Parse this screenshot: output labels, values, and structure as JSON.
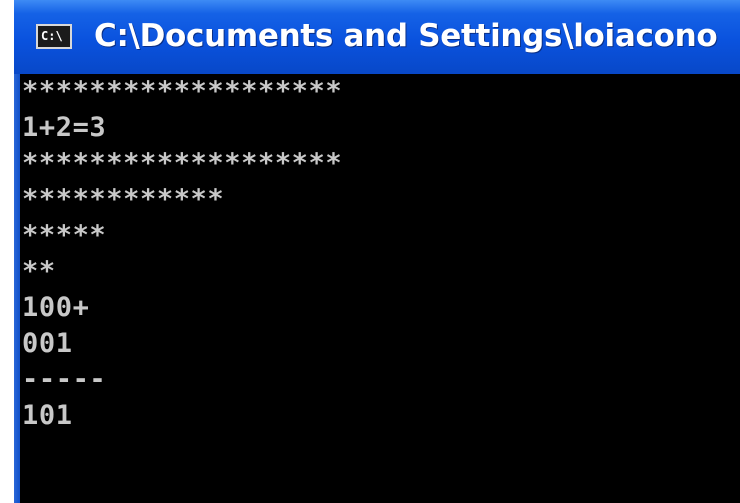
{
  "window": {
    "title": "C:\\Documents and Settings\\loiacono",
    "icon_name": "console-app-icon",
    "icon_text": "C:\\",
    "colors": {
      "titlebar": "#0a52de",
      "console_background": "#000000",
      "console_text": "#c0c0c0"
    }
  },
  "console": {
    "lines": [
      "*******************",
      "1+2=3",
      "*******************",
      "************",
      "*****",
      "**",
      "100+",
      "001",
      "-----",
      "101"
    ]
  }
}
